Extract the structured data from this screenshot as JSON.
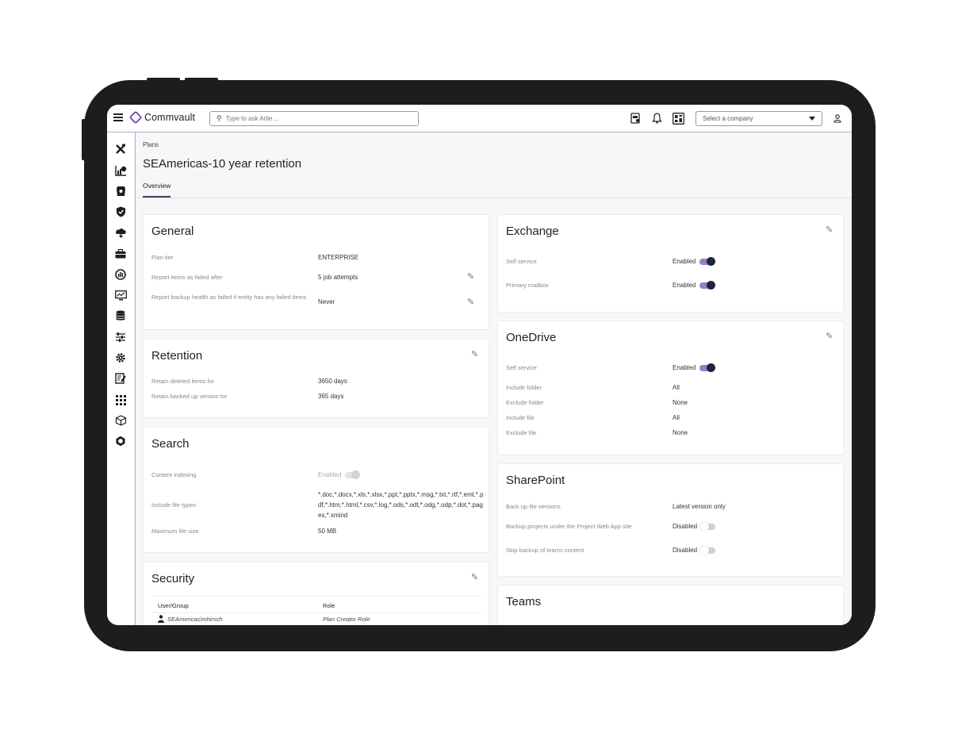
{
  "topbar": {
    "brand": "Commvault",
    "search_placeholder": "Type to ask Arlie ...",
    "company_select": "Select a company"
  },
  "header": {
    "breadcrumb": "Plans",
    "title": "SEAmericas-10 year retention",
    "tab": "Overview"
  },
  "general": {
    "title": "General",
    "rows": [
      {
        "label": "Plan tier",
        "value": "ENTERPRISE"
      },
      {
        "label": "Report items as failed after",
        "value": "5 job attempts"
      },
      {
        "label": "Report backup health as failed if entity has any failed items",
        "value": "Never"
      }
    ]
  },
  "retention": {
    "title": "Retention",
    "rows": [
      {
        "label": "Retain deleted items for",
        "value": "3650 days"
      },
      {
        "label": "Retain backed up version for",
        "value": "365 days"
      }
    ]
  },
  "search_card": {
    "title": "Search",
    "rows": [
      {
        "label": "Content indexing",
        "value": "Enabled"
      },
      {
        "label": "Include file types",
        "value": "*.doc,*.docx,*.xls,*.xlsx,*.ppt,*.pptx,*.msg,*.txt,*.rtf,*.eml,*.pdf,*.htm,*.html,*.csv,*.log,*.ods,*.odt,*.odg,*.odp,*.dot,*.pages,*.xmind"
      },
      {
        "label": "Maximum file size",
        "value": "50 MB"
      }
    ]
  },
  "security": {
    "title": "Security",
    "columns": [
      "User/Group",
      "Role"
    ],
    "rows": [
      {
        "user": "SEAmericas\\mhirsch",
        "role": "Plan Creator Role"
      }
    ]
  },
  "exchange": {
    "title": "Exchange",
    "rows": [
      {
        "label": "Self service",
        "value": "Enabled",
        "on": true
      },
      {
        "label": "Primary mailbox",
        "value": "Enabled",
        "on": true
      }
    ]
  },
  "onedrive": {
    "title": "OneDrive",
    "rows": [
      {
        "label": "Self service",
        "value": "Enabled",
        "on": true
      },
      {
        "label": "Include folder",
        "value": "All"
      },
      {
        "label": "Exclude folder",
        "value": "None"
      },
      {
        "label": "Include file",
        "value": "All"
      },
      {
        "label": "Exclude file",
        "value": "None"
      }
    ]
  },
  "sharepoint": {
    "title": "SharePoint",
    "rows": [
      {
        "label": "Back up file versions",
        "value": "Latest version only"
      },
      {
        "label": "Backup projects under the Project Web App site",
        "value": "Disabled",
        "on": false
      },
      {
        "label": "Skip backup of teams content",
        "value": "Disabled",
        "on": false
      }
    ]
  },
  "teams": {
    "title": "Teams"
  },
  "colors": {
    "accent": "#6a3d9a",
    "frame": "#1b1d1f",
    "toggle_on": "#9a7fc4",
    "toggle_knob": "#1d2440"
  }
}
